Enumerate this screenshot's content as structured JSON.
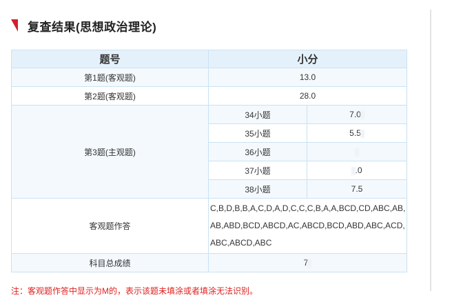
{
  "section_title": "复查结果(思想政治理论)",
  "table": {
    "header": {
      "col1": "题号",
      "col2": "小分"
    },
    "rows": [
      {
        "label": "第1题(客观题)",
        "score": "13.0"
      },
      {
        "label": "第2题(客观题)",
        "score": "28.0"
      }
    ],
    "subjective": {
      "label": "第3题(主观题)",
      "items": [
        {
          "name": "34小题",
          "score": "7.0"
        },
        {
          "name": "35小题",
          "score": "5.5"
        },
        {
          "name": "36小题",
          "score": ""
        },
        {
          "name": "37小题",
          "score": ".0"
        },
        {
          "name": "38小题",
          "score": "7.5"
        }
      ]
    },
    "objective_answers": {
      "label": "客观题作答",
      "value": "C,B,D,B,B,A,C,D,A,D,C,C,C,B,A,A,BCD,CD,ABC,AB,AB,ABD,BCD,ABCD,AC,ABCD,BCD,ABD,ABC,ACD,ABC,ABCD,ABC"
    },
    "total": {
      "label": "科目总成绩",
      "value": "7"
    }
  },
  "footnote": "注：客观题作答中显示为M的，表示该题未填涂或者填涂无法识别。",
  "colors": {
    "accent": "#d0222d",
    "table_border": "#c9e2f2",
    "header_bg": "#e4f1fb",
    "row_shade": "#f4f9fd",
    "note_text": "#e02020"
  }
}
